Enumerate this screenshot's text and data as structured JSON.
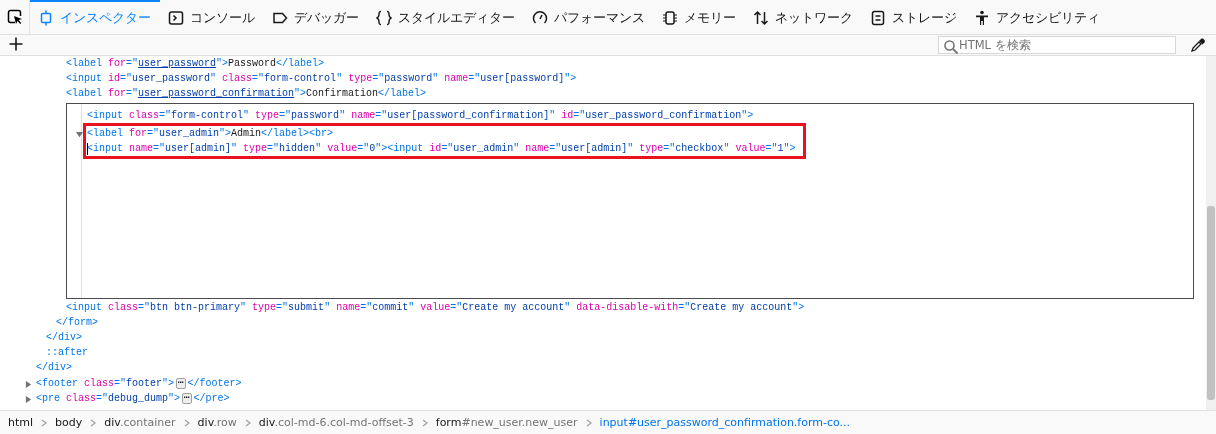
{
  "toolbar": {
    "tabs": [
      {
        "label": "インスペクター",
        "selected": true
      },
      {
        "label": "コンソール",
        "selected": false
      },
      {
        "label": "デバッガー",
        "selected": false
      },
      {
        "label": "スタイルエディター",
        "selected": false
      },
      {
        "label": "パフォーマンス",
        "selected": false
      },
      {
        "label": "メモリー",
        "selected": false
      },
      {
        "label": "ネットワーク",
        "selected": false
      },
      {
        "label": "ストレージ",
        "selected": false
      },
      {
        "label": "アクセシビリティ",
        "selected": false
      }
    ]
  },
  "search": {
    "placeholder": "HTML を検索"
  },
  "markup": [
    {
      "children": [
        {
          "children": [
            {
              "children": [
                {
                  "tokens": [
                    {
                      "kind": "tag",
                      "t": "<label "
                    },
                    {
                      "kind": "attr",
                      "t": "for"
                    },
                    {
                      "kind": "tag",
                      "t": "=\""
                    },
                    {
                      "kind": "link",
                      "t": "user_password"
                    },
                    {
                      "kind": "tag",
                      "t": "\">"
                    },
                    {
                      "kind": "text",
                      "t": "Password"
                    },
                    {
                      "kind": "tag",
                      "t": "</label>"
                    }
                  ]
                },
                {
                  "tokens": [
                    {
                      "kind": "tag",
                      "t": "<input "
                    },
                    {
                      "kind": "attr",
                      "t": "id"
                    },
                    {
                      "kind": "tag",
                      "t": "=\""
                    },
                    {
                      "kind": "value",
                      "t": "user_password"
                    },
                    {
                      "kind": "tag",
                      "t": "\" "
                    },
                    {
                      "kind": "attr",
                      "t": "class"
                    },
                    {
                      "kind": "tag",
                      "t": "=\""
                    },
                    {
                      "kind": "value",
                      "t": "form-control"
                    },
                    {
                      "kind": "tag",
                      "t": "\" "
                    },
                    {
                      "kind": "attr",
                      "t": "type"
                    },
                    {
                      "kind": "tag",
                      "t": "=\""
                    },
                    {
                      "kind": "value",
                      "t": "password"
                    },
                    {
                      "kind": "tag",
                      "t": "\" "
                    },
                    {
                      "kind": "attr",
                      "t": "name"
                    },
                    {
                      "kind": "tag",
                      "t": "=\""
                    },
                    {
                      "kind": "value",
                      "t": "user[password]"
                    },
                    {
                      "kind": "tag",
                      "t": "\">"
                    }
                  ]
                },
                {
                  "tokens": [
                    {
                      "kind": "tag",
                      "t": "<label "
                    },
                    {
                      "kind": "attr",
                      "t": "for"
                    },
                    {
                      "kind": "tag",
                      "t": "=\""
                    },
                    {
                      "kind": "link",
                      "t": "user_password_confirmation"
                    },
                    {
                      "kind": "tag",
                      "t": "\">"
                    },
                    {
                      "kind": "text",
                      "t": "Confirmation"
                    },
                    {
                      "kind": "tag",
                      "t": "</label>"
                    }
                  ]
                },
                {
                  "kind": "editor",
                  "lines": [
                    {
                      "tokens": [
                        {
                          "kind": "tag",
                          "t": "<input "
                        },
                        {
                          "kind": "attr",
                          "t": "class"
                        },
                        {
                          "kind": "tag",
                          "t": "=\""
                        },
                        {
                          "kind": "value",
                          "t": "form-control"
                        },
                        {
                          "kind": "tag",
                          "t": "\" "
                        },
                        {
                          "kind": "attr",
                          "t": "type"
                        },
                        {
                          "kind": "tag",
                          "t": "=\""
                        },
                        {
                          "kind": "value",
                          "t": "password"
                        },
                        {
                          "kind": "tag",
                          "t": "\" "
                        },
                        {
                          "kind": "attr",
                          "t": "name"
                        },
                        {
                          "kind": "tag",
                          "t": "=\""
                        },
                        {
                          "kind": "value",
                          "t": "user[password_confirmation]"
                        },
                        {
                          "kind": "tag",
                          "t": "\" "
                        },
                        {
                          "kind": "attr",
                          "t": "id"
                        },
                        {
                          "kind": "tag",
                          "t": "=\""
                        },
                        {
                          "kind": "value",
                          "t": "user_password_confirmation"
                        },
                        {
                          "kind": "tag",
                          "t": "\">"
                        }
                      ]
                    },
                    {
                      "kind": "highlight",
                      "lines": [
                        {
                          "expanded": true,
                          "tokens": [
                            {
                              "kind": "tag",
                              "t": "<label "
                            },
                            {
                              "kind": "attr",
                              "t": "for"
                            },
                            {
                              "kind": "tag",
                              "t": "=\""
                            },
                            {
                              "kind": "value",
                              "t": "user_admin"
                            },
                            {
                              "kind": "tag",
                              "t": "\">"
                            },
                            {
                              "kind": "text",
                              "t": "Admin"
                            },
                            {
                              "kind": "tag",
                              "t": "</label><br>"
                            }
                          ]
                        },
                        {
                          "cursor": true,
                          "tokens": [
                            {
                              "kind": "tag",
                              "t": "<input "
                            },
                            {
                              "kind": "attr",
                              "t": "name"
                            },
                            {
                              "kind": "tag",
                              "t": "=\""
                            },
                            {
                              "kind": "value",
                              "t": "user[admin]"
                            },
                            {
                              "kind": "tag",
                              "t": "\" "
                            },
                            {
                              "kind": "attr",
                              "t": "type"
                            },
                            {
                              "kind": "tag",
                              "t": "=\""
                            },
                            {
                              "kind": "value",
                              "t": "hidden"
                            },
                            {
                              "kind": "tag",
                              "t": "\" "
                            },
                            {
                              "kind": "attr",
                              "t": "value"
                            },
                            {
                              "kind": "tag",
                              "t": "=\""
                            },
                            {
                              "kind": "value",
                              "t": "0"
                            },
                            {
                              "kind": "tag",
                              "t": "\"><input "
                            },
                            {
                              "kind": "attr",
                              "t": "id"
                            },
                            {
                              "kind": "tag",
                              "t": "=\""
                            },
                            {
                              "kind": "value",
                              "t": "user_admin"
                            },
                            {
                              "kind": "tag",
                              "t": "\" "
                            },
                            {
                              "kind": "attr",
                              "t": "name"
                            },
                            {
                              "kind": "tag",
                              "t": "=\""
                            },
                            {
                              "kind": "value",
                              "t": "user[admin]"
                            },
                            {
                              "kind": "tag",
                              "t": "\" "
                            },
                            {
                              "kind": "attr",
                              "t": "type"
                            },
                            {
                              "kind": "tag",
                              "t": "=\""
                            },
                            {
                              "kind": "value",
                              "t": "checkbox"
                            },
                            {
                              "kind": "tag",
                              "t": "\" "
                            },
                            {
                              "kind": "attr",
                              "t": "value"
                            },
                            {
                              "kind": "tag",
                              "t": "=\""
                            },
                            {
                              "kind": "value",
                              "t": "1"
                            },
                            {
                              "kind": "tag",
                              "t": "\">"
                            }
                          ]
                        }
                      ]
                    }
                  ]
                },
                {
                  "tokens": [
                    {
                      "kind": "tag",
                      "t": "<input "
                    },
                    {
                      "kind": "attr",
                      "t": "class"
                    },
                    {
                      "kind": "tag",
                      "t": "=\""
                    },
                    {
                      "kind": "value",
                      "t": "btn btn-primary"
                    },
                    {
                      "kind": "tag",
                      "t": "\" "
                    },
                    {
                      "kind": "attr",
                      "t": "type"
                    },
                    {
                      "kind": "tag",
                      "t": "=\""
                    },
                    {
                      "kind": "value",
                      "t": "submit"
                    },
                    {
                      "kind": "tag",
                      "t": "\" "
                    },
                    {
                      "kind": "attr",
                      "t": "name"
                    },
                    {
                      "kind": "tag",
                      "t": "=\""
                    },
                    {
                      "kind": "value",
                      "t": "commit"
                    },
                    {
                      "kind": "tag",
                      "t": "\" "
                    },
                    {
                      "kind": "attr",
                      "t": "value"
                    },
                    {
                      "kind": "tag",
                      "t": "=\""
                    },
                    {
                      "kind": "value",
                      "t": "Create my account"
                    },
                    {
                      "kind": "tag",
                      "t": "\" "
                    },
                    {
                      "kind": "attr",
                      "t": "data-disable-with"
                    },
                    {
                      "kind": "tag",
                      "t": "=\""
                    },
                    {
                      "kind": "value",
                      "t": "Create my account"
                    },
                    {
                      "kind": "tag",
                      "t": "\">"
                    }
                  ]
                }
              ]
            },
            {
              "tokens": [
                {
                  "kind": "tag",
                  "t": "</form>"
                }
              ]
            }
          ]
        },
        {
          "tokens": [
            {
              "kind": "tag",
              "t": "</div>"
            }
          ]
        },
        {
          "tokens": [
            {
              "kind": "tag",
              "t": "::after"
            }
          ]
        }
      ]
    },
    {
      "tokens": [
        {
          "kind": "tag",
          "t": "</div>"
        }
      ]
    },
    {
      "expanded": false,
      "tokens": [
        {
          "kind": "tag",
          "t": "<footer "
        },
        {
          "kind": "attr",
          "t": "class"
        },
        {
          "kind": "tag",
          "t": "=\""
        },
        {
          "kind": "value",
          "t": "footer"
        },
        {
          "kind": "tag",
          "t": "\">"
        },
        {
          "kind": "more",
          "t": "⋯"
        },
        {
          "kind": "tag",
          "t": "</footer>"
        }
      ]
    },
    {
      "expanded": false,
      "tokens": [
        {
          "kind": "tag",
          "t": "<pre "
        },
        {
          "kind": "attr",
          "t": "class"
        },
        {
          "kind": "tag",
          "t": "=\""
        },
        {
          "kind": "value",
          "t": "debug_dump"
        },
        {
          "kind": "tag",
          "t": "\">"
        },
        {
          "kind": "more",
          "t": "⋯"
        },
        {
          "kind": "tag",
          "t": "</pre>"
        }
      ]
    }
  ],
  "breadcrumbs": [
    {
      "tag": "html",
      "selected": false
    },
    {
      "tag": "body",
      "selected": false
    },
    {
      "tag": "div",
      "rest": ".container",
      "selected": false
    },
    {
      "tag": "div",
      "rest": ".row",
      "selected": false
    },
    {
      "tag": "div",
      "rest": ".col-md-6.col-md-offset-3",
      "selected": false
    },
    {
      "tag": "form",
      "rest": "#new_user.new_user",
      "selected": false
    },
    {
      "tag": "input",
      "rest": "#user_password_confirmation.form-co...",
      "selected": true
    }
  ]
}
